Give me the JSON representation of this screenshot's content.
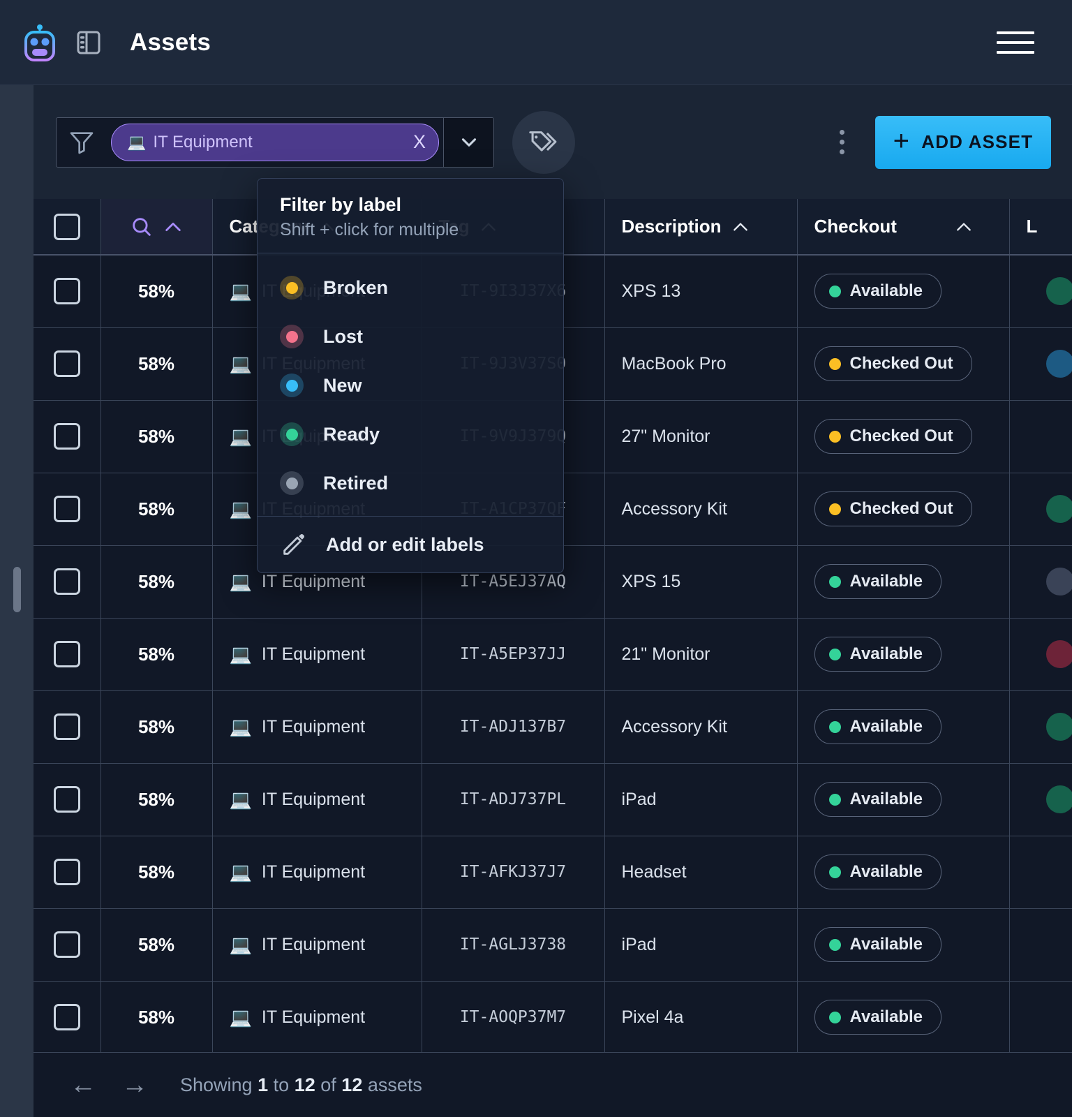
{
  "header": {
    "title": "Assets",
    "logo_icon": "robot-icon",
    "panel_icon": "side-panel-icon",
    "menu_icon": "hamburger-menu-icon"
  },
  "toolbar": {
    "filter_icon": "funnel-icon",
    "chip": {
      "emoji": "💻",
      "label": "IT Equipment",
      "remove": "X"
    },
    "caret_icon": "chevron-down-icon",
    "tags_icon": "tags-icon",
    "kebab_icon": "more-vertical-icon",
    "add_button": {
      "plus": "+",
      "label": "ADD ASSET"
    }
  },
  "label_popup": {
    "title": "Filter by label",
    "subtitle": "Shift + click for multiple",
    "items": [
      {
        "name": "Broken",
        "color": "#fbbf24"
      },
      {
        "name": "Lost",
        "color": "#f4738c"
      },
      {
        "name": "New",
        "color": "#38bdf8"
      },
      {
        "name": "Ready",
        "color": "#34d399"
      },
      {
        "name": "Retired",
        "color": "#9aa5b4"
      }
    ],
    "edit_action": {
      "icon": "pencil-icon",
      "label": "Add or edit labels"
    }
  },
  "table": {
    "columns": [
      {
        "key": "check",
        "label": "",
        "sort": false
      },
      {
        "key": "search",
        "label": "",
        "sort": true
      },
      {
        "key": "category",
        "label": "Category",
        "sort": true
      },
      {
        "key": "tag",
        "label": "Tag",
        "sort": true
      },
      {
        "key": "desc",
        "label": "Description",
        "sort": true
      },
      {
        "key": "checkout",
        "label": "Checkout",
        "sort": true
      },
      {
        "key": "labels",
        "label": "L",
        "sort": false
      }
    ],
    "rows": [
      {
        "pct": "58%",
        "emoji": "💻",
        "category": "IT Equipment",
        "tag": "IT-9I3J37X6",
        "desc": "XPS 13",
        "checkout": "Available",
        "checkout_color": "#34d399",
        "label_color": "#16624c"
      },
      {
        "pct": "58%",
        "emoji": "💻",
        "category": "IT Equipment",
        "tag": "IT-9J3V37S0",
        "desc": "MacBook Pro",
        "checkout": "Checked Out",
        "checkout_color": "#fbbf24",
        "label_color": "#1d5a83"
      },
      {
        "pct": "58%",
        "emoji": "💻",
        "category": "IT Equipment",
        "tag": "IT-9V9J379Q",
        "desc": "27\" Monitor",
        "checkout": "Checked Out",
        "checkout_color": "#fbbf24",
        "label_color": ""
      },
      {
        "pct": "58%",
        "emoji": "💻",
        "category": "IT Equipment",
        "tag": "IT-A1CP37QF",
        "desc": "Accessory Kit",
        "checkout": "Checked Out",
        "checkout_color": "#fbbf24",
        "label_color": "#16624c"
      },
      {
        "pct": "58%",
        "emoji": "💻",
        "category": "IT Equipment",
        "tag": "IT-A5EJ37AQ",
        "desc": "XPS 15",
        "checkout": "Available",
        "checkout_color": "#34d399",
        "label_color": "#3a4357"
      },
      {
        "pct": "58%",
        "emoji": "💻",
        "category": "IT Equipment",
        "tag": "IT-A5EP37JJ",
        "desc": "21\" Monitor",
        "checkout": "Available",
        "checkout_color": "#34d399",
        "label_color": "#6d2338"
      },
      {
        "pct": "58%",
        "emoji": "💻",
        "category": "IT Equipment",
        "tag": "IT-ADJ137B7",
        "desc": "Accessory Kit",
        "checkout": "Available",
        "checkout_color": "#34d399",
        "label_color": "#16624c"
      },
      {
        "pct": "58%",
        "emoji": "💻",
        "category": "IT Equipment",
        "tag": "IT-ADJ737PL",
        "desc": "iPad",
        "checkout": "Available",
        "checkout_color": "#34d399",
        "label_color": "#16624c"
      },
      {
        "pct": "58%",
        "emoji": "💻",
        "category": "IT Equipment",
        "tag": "IT-AFKJ37J7",
        "desc": "Headset",
        "checkout": "Available",
        "checkout_color": "#34d399",
        "label_color": ""
      },
      {
        "pct": "58%",
        "emoji": "💻",
        "category": "IT Equipment",
        "tag": "IT-AGLJ3738",
        "desc": "iPad",
        "checkout": "Available",
        "checkout_color": "#34d399",
        "label_color": ""
      },
      {
        "pct": "58%",
        "emoji": "💻",
        "category": "IT Equipment",
        "tag": "IT-AOQP37M7",
        "desc": "Pixel 4a",
        "checkout": "Available",
        "checkout_color": "#34d399",
        "label_color": ""
      }
    ]
  },
  "footer": {
    "prev_icon": "arrow-left-icon",
    "next_icon": "arrow-right-icon",
    "showing_prefix": "Showing",
    "from": "1",
    "to_word": "to",
    "to": "12",
    "of_word": "of",
    "total": "12",
    "suffix": "assets"
  },
  "colors": {
    "accent": "#38bdf8",
    "chip": "#4c3a8c",
    "chip_border": "#a78bfa",
    "available": "#34d399",
    "checked_out": "#fbbf24"
  }
}
